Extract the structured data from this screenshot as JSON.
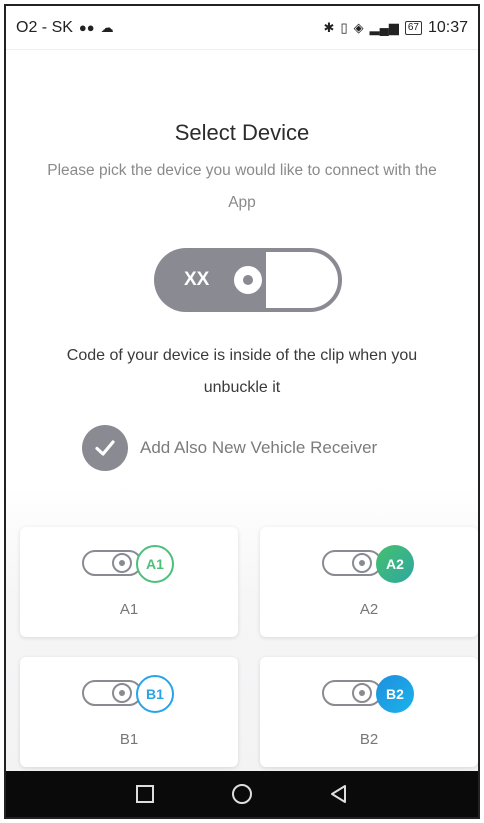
{
  "status_bar": {
    "carrier": "O2 - SK",
    "battery": "67",
    "time": "10:37"
  },
  "screen": {
    "title": "Select Device",
    "subtitle": "Please pick the device you would like to connect with the App",
    "clip_code": "XX",
    "hint": "Code of your device is inside of the clip when you unbuckle it",
    "add_new_label": "Add Also New Vehicle Receiver",
    "add_new_checked": true
  },
  "devices": [
    {
      "code": "A1",
      "label": "A1",
      "style": "a1-outline",
      "color": "#4cc07a"
    },
    {
      "code": "A2",
      "label": "A2",
      "style": "a2-filled",
      "color": "#3bb58a"
    },
    {
      "code": "B1",
      "label": "B1",
      "style": "b1-outline",
      "color": "#27a4e8"
    },
    {
      "code": "B2",
      "label": "B2",
      "style": "b2-filled",
      "color": "#1f9ee3"
    }
  ],
  "nav": {
    "recent_icon": "square-icon",
    "home_icon": "circle-icon",
    "back_icon": "triangle-back-icon"
  }
}
